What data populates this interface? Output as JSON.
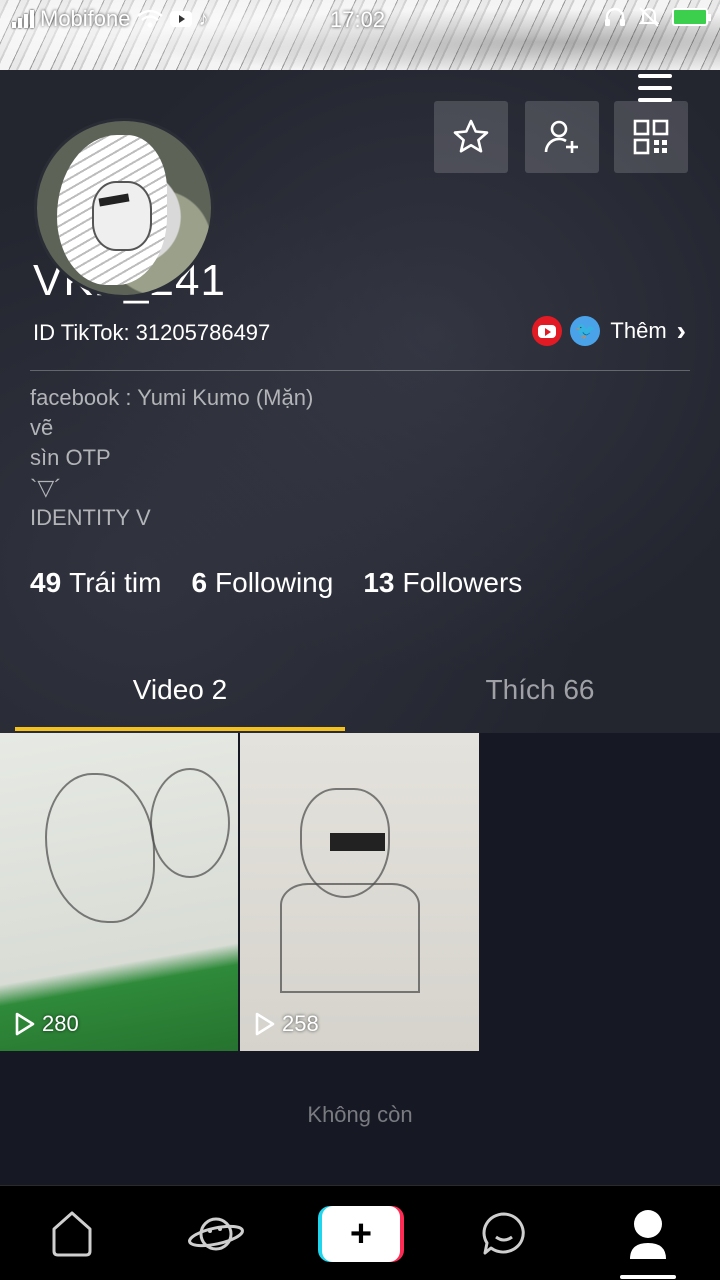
{
  "status_bar": {
    "carrier": "Mobifone",
    "time": "17:02"
  },
  "profile": {
    "username": "VKP_241",
    "tiktok_id": "ID TikTok: 31205786497",
    "more_label": "Thêm",
    "bio_lines": [
      "facebook : Yumi Kumo (Mặn)",
      "vẽ",
      "sìn OTP",
      "`▽´",
      "IDENTITY V"
    ]
  },
  "stats": {
    "hearts_count": "49",
    "hearts_label": "Trái tim",
    "following_count": "6",
    "following_label": "Following",
    "followers_count": "13",
    "followers_label": "Followers"
  },
  "tabs": {
    "videos_label": "Video 2",
    "liked_label": "Thích 66"
  },
  "videos": [
    {
      "views": "280"
    },
    {
      "views": "258"
    }
  ],
  "footer": {
    "no_more": "Không còn"
  },
  "colors": {
    "accent_tab_underline": "#f4c21a",
    "youtube_red": "#e21a23",
    "twitter_blue": "#4aa3e9",
    "create_cyan": "#20d5ec",
    "create_pink": "#fe2c55"
  },
  "icons": [
    "signal-icon",
    "wifi-icon",
    "youtube-status-icon",
    "tiktok-status-icon",
    "headphones-icon",
    "mute-icon",
    "battery-icon",
    "menu-icon",
    "star-icon",
    "add-user-icon",
    "qr-code-icon",
    "youtube-icon",
    "twitter-icon",
    "chevron-right-icon",
    "play-icon",
    "home-icon",
    "discover-planet-icon",
    "plus-icon",
    "inbox-chat-icon",
    "profile-icon"
  ]
}
